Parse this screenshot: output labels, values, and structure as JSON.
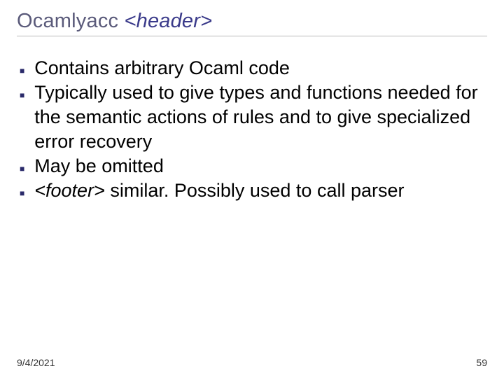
{
  "title": {
    "plain": "Ocamlyacc ",
    "italic": "<header>"
  },
  "bullets": [
    {
      "text": "Contains arbitrary Ocaml code"
    },
    {
      "text": "Typically used to give types and functions needed for the semantic actions of rules and to give specialized error recovery"
    },
    {
      "text": "May be omitted"
    },
    {
      "italic_prefix": "<footer>",
      "text": " similar.  Possibly used to call parser"
    }
  ],
  "footer": {
    "date": "9/4/2021",
    "page": "59"
  }
}
